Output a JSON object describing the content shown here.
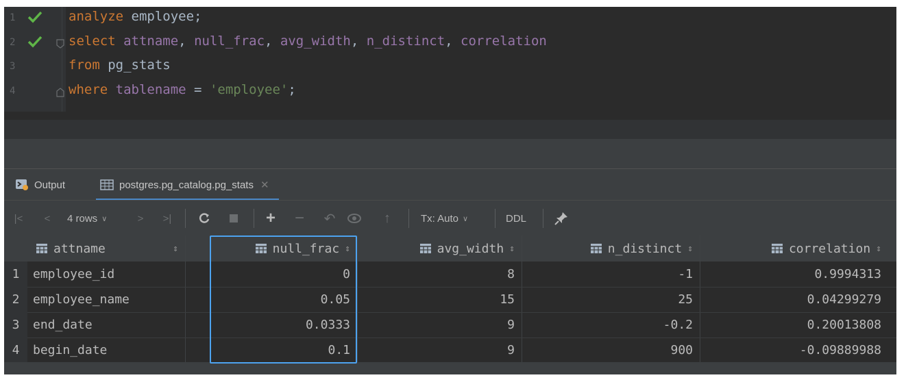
{
  "editor": {
    "lines": [
      {
        "num": "1",
        "status": "ok",
        "tokens": [
          {
            "t": "kw",
            "v": "analyze"
          },
          {
            "t": "plain",
            "v": " employee;"
          }
        ]
      },
      {
        "num": "2",
        "status": "ok",
        "tokens": [
          {
            "t": "kw",
            "v": "select"
          },
          {
            "t": "plain",
            "v": " "
          },
          {
            "t": "id",
            "v": "attname"
          },
          {
            "t": "plain",
            "v": ", "
          },
          {
            "t": "id",
            "v": "null_frac"
          },
          {
            "t": "plain",
            "v": ", "
          },
          {
            "t": "id",
            "v": "avg_width"
          },
          {
            "t": "plain",
            "v": ", "
          },
          {
            "t": "id",
            "v": "n_distinct"
          },
          {
            "t": "plain",
            "v": ", "
          },
          {
            "t": "id",
            "v": "correlation"
          }
        ]
      },
      {
        "num": "3",
        "status": "",
        "tokens": [
          {
            "t": "kw",
            "v": "from"
          },
          {
            "t": "plain",
            "v": " pg_stats"
          }
        ]
      },
      {
        "num": "4",
        "status": "",
        "tokens": [
          {
            "t": "kw",
            "v": "where"
          },
          {
            "t": "plain",
            "v": " "
          },
          {
            "t": "id",
            "v": "tablename"
          },
          {
            "t": "plain",
            "v": " = "
          },
          {
            "t": "str",
            "v": "'employee'"
          },
          {
            "t": "plain",
            "v": ";"
          }
        ]
      }
    ]
  },
  "tabs": {
    "output": "Output",
    "stats": "postgres.pg_catalog.pg_stats"
  },
  "toolbar": {
    "rows": "4 rows",
    "tx": "Tx: Auto",
    "ddl": "DDL"
  },
  "grid": {
    "columns": [
      "attname",
      "null_frac",
      "avg_width",
      "n_distinct",
      "correlation"
    ],
    "rows": [
      {
        "n": "1",
        "cells": [
          "employee_id",
          "0",
          "8",
          "-1",
          "0.9994313"
        ]
      },
      {
        "n": "2",
        "cells": [
          "employee_name",
          "0.05",
          "15",
          "25",
          "0.04299279"
        ]
      },
      {
        "n": "3",
        "cells": [
          "end_date",
          "0.0333",
          "9",
          "-0.2",
          "0.20013808"
        ]
      },
      {
        "n": "4",
        "cells": [
          "begin_date",
          "0.1",
          "9",
          "900",
          "-0.09889988"
        ]
      }
    ],
    "highlighted_column": "null_frac"
  },
  "colors": {
    "keyword": "#cc7832",
    "identifier": "#9876aa",
    "string": "#6a8759",
    "check": "#5fb548",
    "highlight_border": "#4da3f0"
  }
}
